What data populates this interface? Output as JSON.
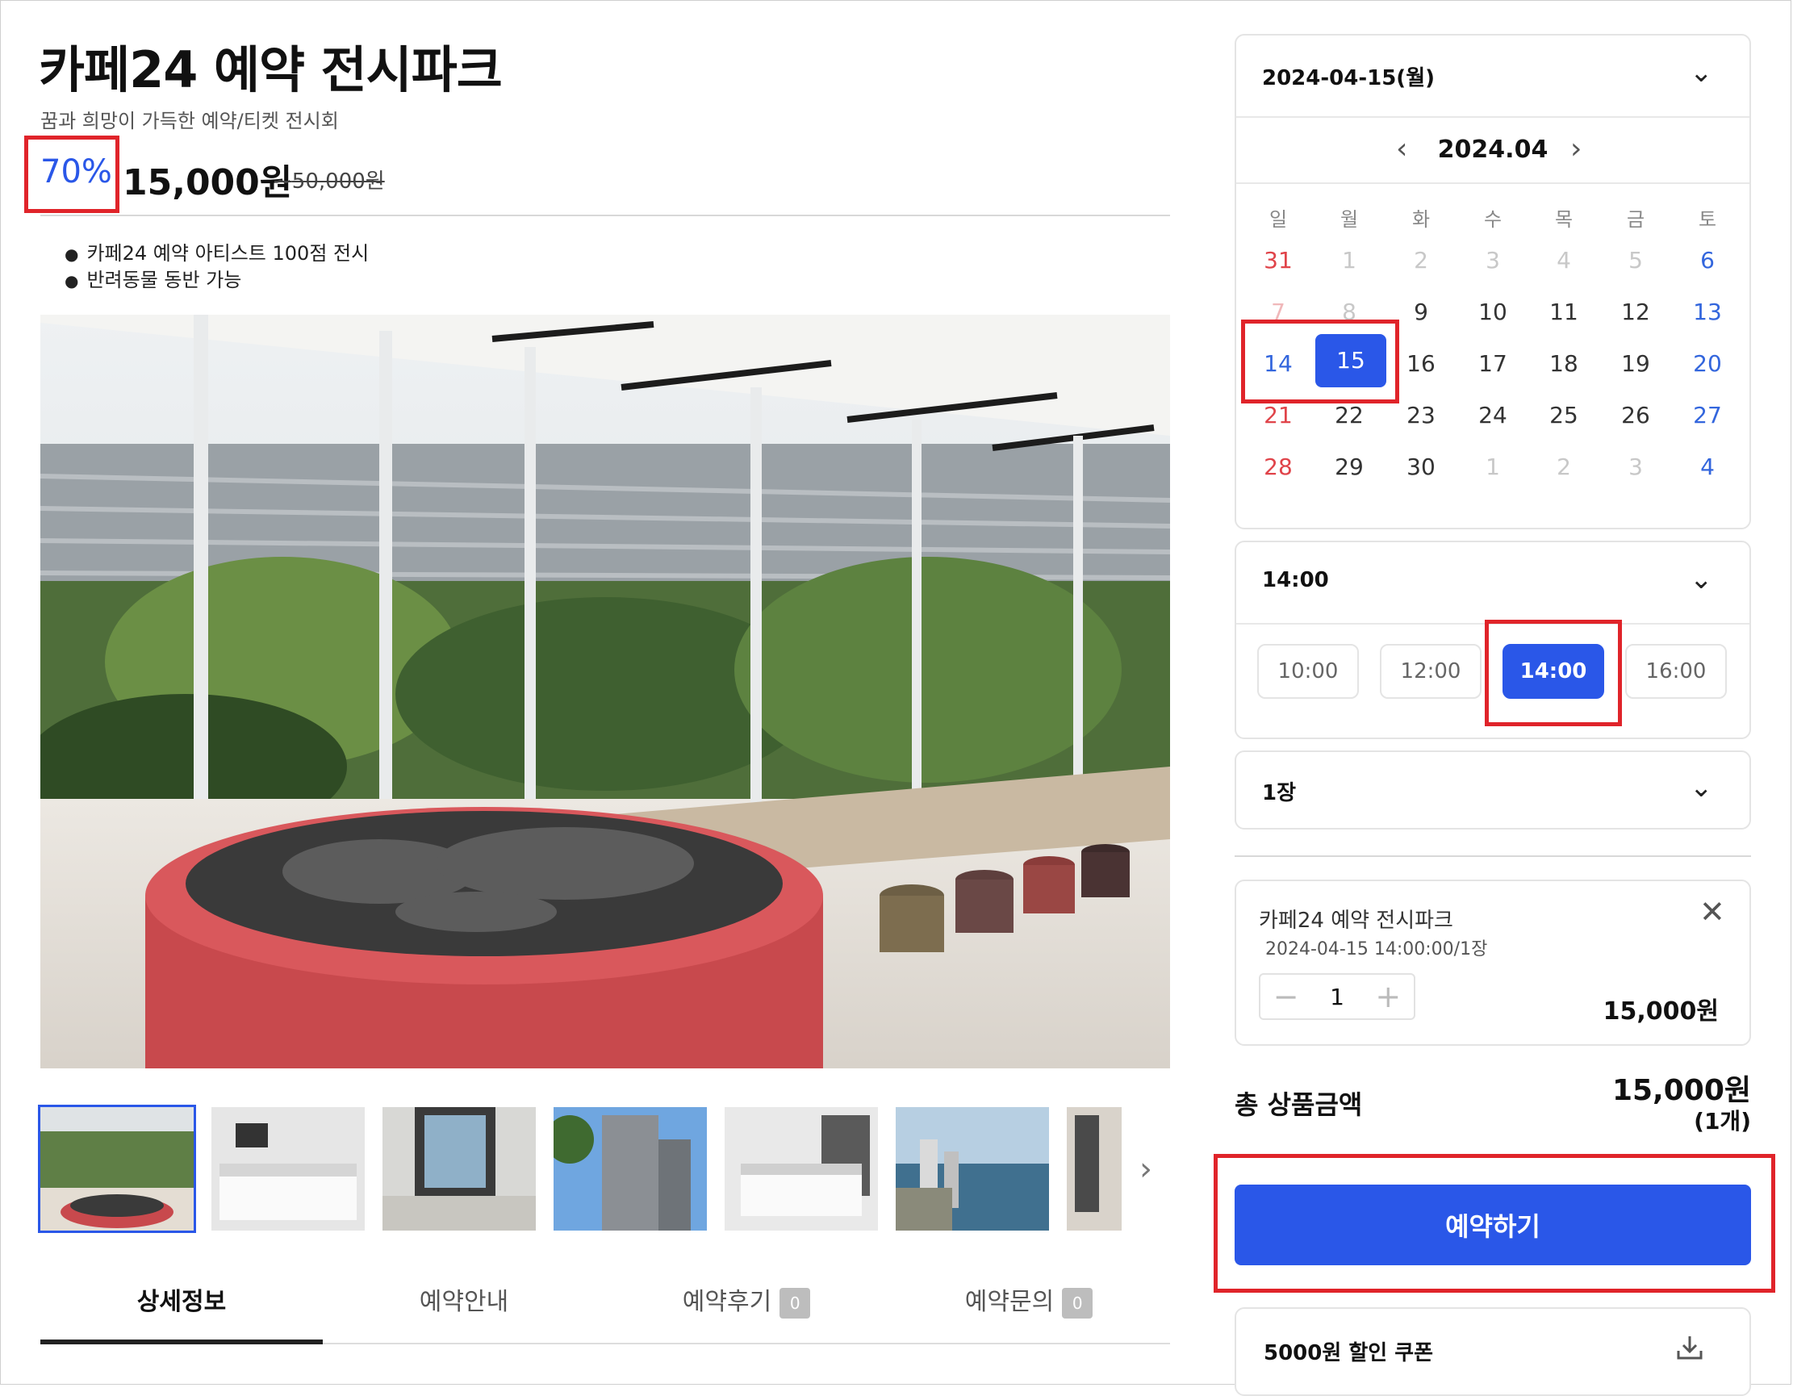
{
  "product": {
    "title": "카페24 예약 전시파크",
    "subtitle": "꿈과 희망이 가득한 예약/티켓 전시회",
    "discount": "70%",
    "price": "15,000원",
    "original_price": "50,000원",
    "features": [
      "카페24 예약 아티스트 100점 전시",
      "반려동물 동반 가능"
    ]
  },
  "gallery": {
    "thumbnails": [
      "exhibition-hall",
      "hotel-room-beds",
      "room-window-view",
      "tower-building",
      "hotel-room-twin",
      "coastal-city-view",
      "hotel-interior"
    ]
  },
  "tabs": [
    {
      "label": "상세정보",
      "badge": ""
    },
    {
      "label": "예약안내",
      "badge": ""
    },
    {
      "label": "예약후기",
      "badge": "0"
    },
    {
      "label": "예약문의",
      "badge": "0"
    }
  ],
  "booking": {
    "date_select": "2024-04-15(월)",
    "calendar": {
      "month": "2024.04",
      "weekdays": [
        "일",
        "월",
        "화",
        "수",
        "목",
        "금",
        "토"
      ],
      "weeks": [
        [
          "31",
          "1",
          "2",
          "3",
          "4",
          "5",
          "6"
        ],
        [
          "7",
          "8",
          "9",
          "10",
          "11",
          "12",
          "13"
        ],
        [
          "14",
          "15",
          "16",
          "17",
          "18",
          "19",
          "20"
        ],
        [
          "21",
          "22",
          "23",
          "24",
          "25",
          "26",
          "27"
        ],
        [
          "28",
          "29",
          "30",
          "1",
          "2",
          "3",
          "4"
        ]
      ],
      "selected_day": "15"
    },
    "time_select": "14:00",
    "times": [
      "10:00",
      "12:00",
      "14:00",
      "16:00"
    ],
    "selected_time": "14:00",
    "quantity_select": "1장",
    "item": {
      "name": "카페24 예약 전시파크",
      "option": "2024-04-15 14:00:00/1장",
      "quantity": "1",
      "price": "15,000원"
    },
    "total_label": "총 상품금액",
    "total_price": "15,000원",
    "total_count": "(1개)",
    "reserve_button": "예약하기",
    "coupon": "5000원 할인 쿠폰"
  },
  "colors": {
    "accent": "#2a57e8",
    "highlight": "#e0242a",
    "sunday": "#e0444a",
    "saturday": "#3366dd"
  }
}
